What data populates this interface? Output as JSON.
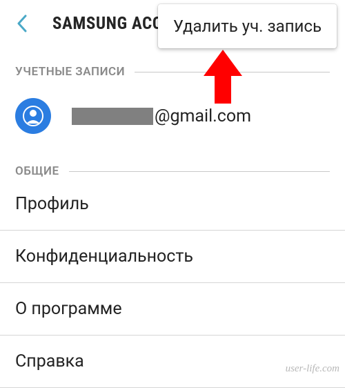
{
  "header": {
    "title": "SAMSUNG ACCOUNT"
  },
  "popup": {
    "delete_label": "Удалить уч. запись"
  },
  "sections": {
    "accounts_label": "УЧЕТНЫЕ ЗАПИСИ",
    "general_label": "ОБЩИЕ"
  },
  "account": {
    "email_domain": "@gmail.com"
  },
  "menu": {
    "profile": "Профиль",
    "privacy": "Конфиденциальность",
    "about": "О программе",
    "help": "Справка"
  },
  "watermark": "user-life.com",
  "colors": {
    "accent": "#4aa8c7",
    "icon_bg": "#2b7de1",
    "arrow": "#ff0000"
  }
}
